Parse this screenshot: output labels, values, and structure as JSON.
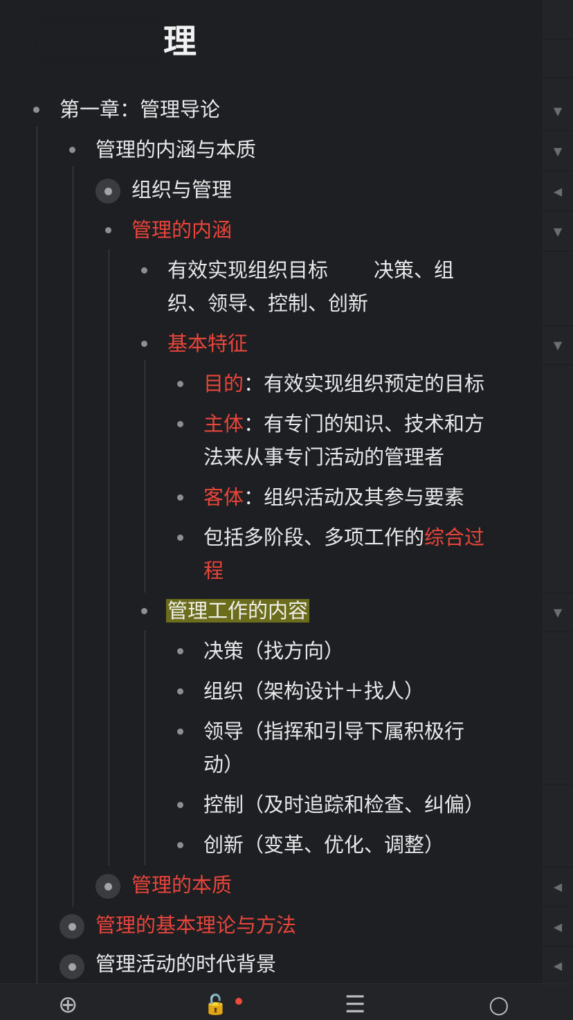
{
  "title": "理",
  "outline": {
    "n1": "第一章：管理导论",
    "n2": "管理的内涵与本质",
    "n3": "组织与管理",
    "n4": "管理的内涵",
    "n5a": "有效实现组织目标",
    "n5b": "决策、组",
    "n5c": "织、领导、控制、创新",
    "n6": "基本特征",
    "n7_label": "目的",
    "n7_text": "：有效实现组织预定的目标",
    "n8_label": "主体",
    "n8_text_a": "：有专门的知识、技术和方",
    "n8_text_b": "法来从事专门活动的管理者",
    "n9_label": "客体",
    "n9_text": "：组织活动及其参与要素",
    "n10_a": "包括多阶段、多项工作的",
    "n10_b": "综合过",
    "n10_c": "程",
    "n11": "管理工作的内容",
    "n12": "决策（找方向）",
    "n13": "组织（架构设计＋找人）",
    "n14_a": "领导（指挥和引导下属积极行",
    "n14_b": "动）",
    "n15": "控制（及时追踪和检查、纠偏）",
    "n16": "创新（变革、优化、调整）",
    "n17": "管理的本质",
    "n18": "管理的基本理论与方法",
    "n19": "管理活动的时代背景"
  },
  "rail": {
    "collapse_icon": "▼",
    "expand_icon": "◀"
  },
  "toolbar": {
    "add_icon": "⊕",
    "unlock_icon": "🔓",
    "indent_icon": "☰",
    "search_icon": "○"
  },
  "colors": {
    "background": "#1e1f22",
    "accent_red": "#e9453b",
    "highlight": "#6b6c1c"
  }
}
